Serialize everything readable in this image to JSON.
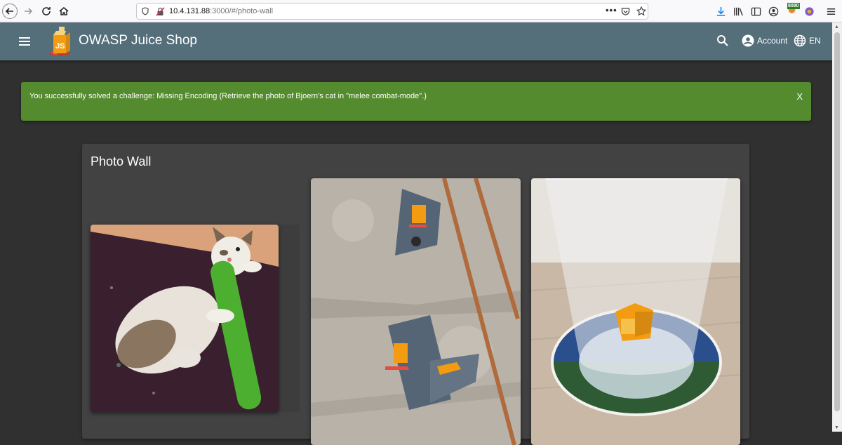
{
  "browser": {
    "url_host": "10.4.131.88",
    "url_rest": ":3000/#/photo-wall",
    "proxy_badge": "8080"
  },
  "app": {
    "title": "OWASP Juice Shop",
    "account_label": "Account",
    "language_label": "EN"
  },
  "banner": {
    "message": "You successfully solved a challenge: Missing Encoding (Retrieve the photo of Bjoern's cat in \"melee combat-mode\".)",
    "close_label": "X",
    "color": "#558b2f"
  },
  "photo_wall": {
    "title": "Photo Wall",
    "photos": [
      "cat-photo",
      "wall-mount-photo",
      "glass-coaster-photo"
    ]
  },
  "colors": {
    "toolbar": "#546e7a",
    "background": "#303030",
    "card": "#424242"
  }
}
